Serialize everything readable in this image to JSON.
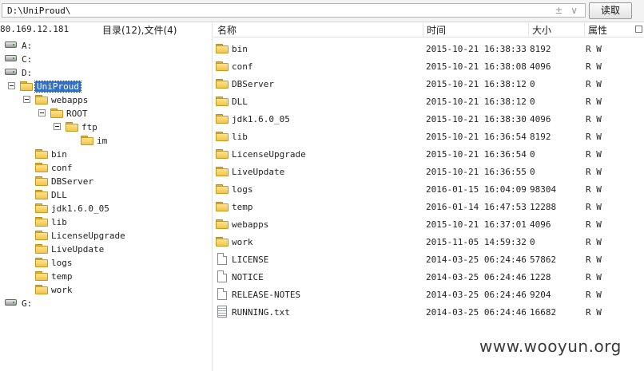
{
  "path_bar": {
    "path": "D:\\UniProud\\",
    "arrows": "± ∨",
    "read_button": "读取"
  },
  "info": {
    "host_ip": "80.169.12.181",
    "counts": "目录(12),文件(4)"
  },
  "tree": {
    "drives": {
      "a": "A:",
      "c": "C:",
      "d": "D:",
      "g": "G:"
    },
    "uniproud": "UniProud",
    "webapps": "webapps",
    "root": "ROOT",
    "ftp": "ftp",
    "im": "im",
    "children": [
      "bin",
      "conf",
      "DBServer",
      "DLL",
      "jdk1.6.0_05",
      "lib",
      "LicenseUpgrade",
      "LiveUpdate",
      "logs",
      "temp",
      "work"
    ]
  },
  "columns": {
    "name": "名称",
    "time": "时间",
    "size": "大小",
    "attr": "属性"
  },
  "files": [
    {
      "name": "bin",
      "time": "2015-10-21 16:38:33",
      "size": "8192",
      "attr": "R W",
      "type": "folder"
    },
    {
      "name": "conf",
      "time": "2015-10-21 16:38:08",
      "size": "4096",
      "attr": "R W",
      "type": "folder"
    },
    {
      "name": "DBServer",
      "time": "2015-10-21 16:38:12",
      "size": "0",
      "attr": "R W",
      "type": "folder"
    },
    {
      "name": "DLL",
      "time": "2015-10-21 16:38:12",
      "size": "0",
      "attr": "R W",
      "type": "folder"
    },
    {
      "name": "jdk1.6.0_05",
      "time": "2015-10-21 16:38:30",
      "size": "4096",
      "attr": "R W",
      "type": "folder"
    },
    {
      "name": "lib",
      "time": "2015-10-21 16:36:54",
      "size": "8192",
      "attr": "R W",
      "type": "folder"
    },
    {
      "name": "LicenseUpgrade",
      "time": "2015-10-21 16:36:54",
      "size": "0",
      "attr": "R W",
      "type": "folder"
    },
    {
      "name": "LiveUpdate",
      "time": "2015-10-21 16:36:55",
      "size": "0",
      "attr": "R W",
      "type": "folder"
    },
    {
      "name": "logs",
      "time": "2016-01-15 16:04:09",
      "size": "98304",
      "attr": "R W",
      "type": "folder"
    },
    {
      "name": "temp",
      "time": "2016-01-14 16:47:53",
      "size": "12288",
      "attr": "R W",
      "type": "folder"
    },
    {
      "name": "webapps",
      "time": "2015-10-21 16:37:01",
      "size": "4096",
      "attr": "R W",
      "type": "folder"
    },
    {
      "name": "work",
      "time": "2015-11-05 14:59:32",
      "size": "0",
      "attr": "R W",
      "type": "folder"
    },
    {
      "name": "LICENSE",
      "time": "2014-03-25 06:24:46",
      "size": "57862",
      "attr": "R W",
      "type": "file"
    },
    {
      "name": "NOTICE",
      "time": "2014-03-25 06:24:46",
      "size": "1228",
      "attr": "R W",
      "type": "file"
    },
    {
      "name": "RELEASE-NOTES",
      "time": "2014-03-25 06:24:46",
      "size": "9204",
      "attr": "R W",
      "type": "file"
    },
    {
      "name": "RUNNING.txt",
      "time": "2014-03-25 06:24:46",
      "size": "16682",
      "attr": "R W",
      "type": "text-file"
    }
  ],
  "watermark": "www.wooyun.org",
  "colors": {
    "selection": "#3470c8",
    "folder": "#f2c44e"
  }
}
